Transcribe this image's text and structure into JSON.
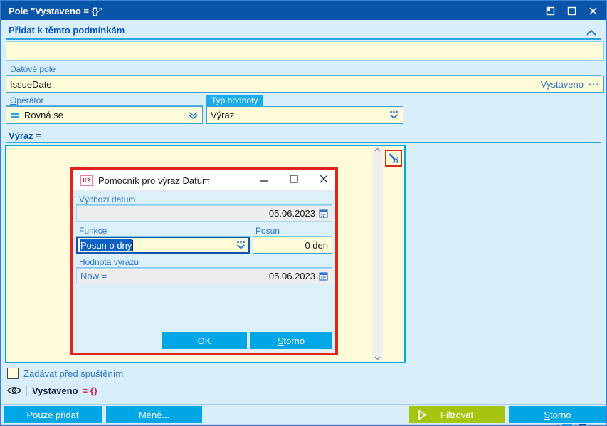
{
  "window": {
    "title": "Pole \"Vystaveno = {}\""
  },
  "add_section": {
    "header": "Přidat k těmto podmínkám",
    "input_value": ""
  },
  "data_field": {
    "label": "Datové pole",
    "value": "IssueDate",
    "field_caption": "Vystaveno",
    "ellipsis": "···"
  },
  "operator": {
    "label_accel": "O",
    "label_rest": "perátor",
    "value": "Rovná se"
  },
  "value_type": {
    "label": "Typ hodnoty",
    "value": "Výraz"
  },
  "expression": {
    "header": "Výraz ="
  },
  "helper_dialog": {
    "icon_text": "K2",
    "title": "Pomocník pro výraz Datum",
    "default_date": {
      "label": "Výchozí datum",
      "value": "05.06.2023"
    },
    "function": {
      "label": "Funkce",
      "value": "Posun o dny"
    },
    "shift": {
      "label": "Posun",
      "value": "0 den"
    },
    "expression_value": {
      "label": "Hodnota výrazu",
      "prefix": "Now =",
      "value": "05.06.2023"
    },
    "ok_label": "OK",
    "cancel_accel": "S",
    "cancel_rest": "torno"
  },
  "footer": {
    "checkbox_label": "Zadávat před spuštěním",
    "preview_field": "Vystaveno",
    "preview_value": "= {}",
    "add_only_label": "Pouze přidat",
    "less_label": "Méně...",
    "filter_label": "Filtrovat",
    "cancel_accel": "S",
    "cancel_rest": "torno"
  },
  "colors": {
    "titlebar_blue": "#0a55a8",
    "accent_cyan": "#00a7e8",
    "button_cyan": "#00a6e6",
    "filter_green": "#a6c50e",
    "highlight_red": "#e0241b",
    "field_yellow": "#fdfbd8",
    "label_blue": "#2e75c8",
    "header_blue": "#0b53c0",
    "preview_red": "#e11948"
  }
}
